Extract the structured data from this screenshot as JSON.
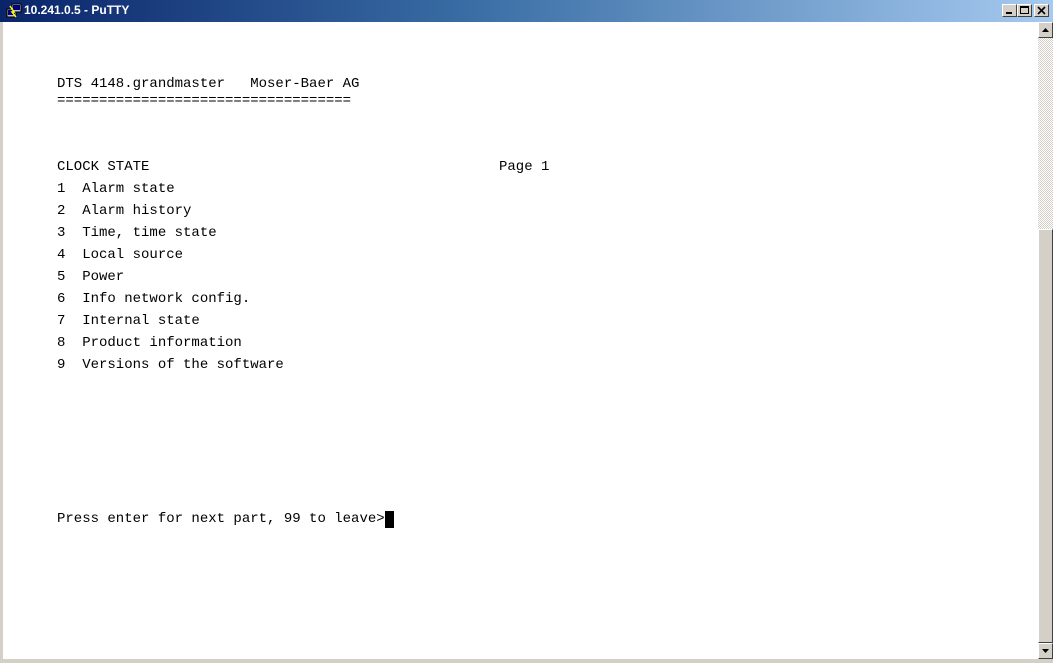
{
  "window": {
    "title": "10.241.0.5 - PuTTY",
    "icon": "putty-icon"
  },
  "terminal": {
    "header": "DTS 4148.grandmaster   Moser-Baer AG",
    "separator": "===================================",
    "section_title": "CLOCK STATE",
    "page_label": "Page 1",
    "menu_items": [
      "1  Alarm state",
      "2  Alarm history",
      "3  Time, time state",
      "4  Local source",
      "5  Power",
      "6  Info network config.",
      "7  Internal state",
      "8  Product information",
      "9  Versions of the software"
    ],
    "prompt": "Press enter for next part, 99 to leave>"
  },
  "colors": {
    "terminal_bg": "#ffffff",
    "terminal_fg": "#000000",
    "titlebar_start": "#0a246a",
    "titlebar_end": "#a6caf0"
  }
}
